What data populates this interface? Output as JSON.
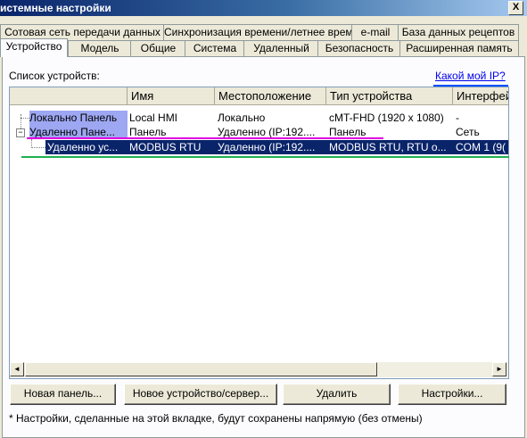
{
  "window": {
    "title": "истемные настройки",
    "close_label": "X"
  },
  "tabs_row1": [
    {
      "label": "Сотовая сеть передачи данных"
    },
    {
      "label": "Синхронизация времени/летнее время"
    },
    {
      "label": "e-mail"
    },
    {
      "label": "База данных рецептов"
    }
  ],
  "tabs_row2": [
    {
      "label": "Устройство",
      "active": true
    },
    {
      "label": "Модель"
    },
    {
      "label": "Общие"
    },
    {
      "label": "Система"
    },
    {
      "label": "Удаленный"
    },
    {
      "label": "Безопасность"
    },
    {
      "label": "Расширенная память"
    }
  ],
  "panel": {
    "list_label": "Список устройств:",
    "ip_link": "Какой мой IP?"
  },
  "table": {
    "columns": [
      "",
      "Имя",
      "Местоположение",
      "Тип устройства",
      "Интерфей"
    ],
    "rows": [
      {
        "tree": "Локально Панель",
        "name": "Local HMI",
        "location": "Локально",
        "type": "cMT-FHD (1920 x 1080)",
        "iface": "-"
      },
      {
        "tree": "Удаленно Пане...",
        "name": "Панель",
        "location": "Удаленно (IP:192....",
        "type": "Панель",
        "iface": "Сеть"
      },
      {
        "tree": "Удаленно ус...",
        "name": "MODBUS RTU",
        "location": "Удаленно (IP:192....",
        "type": "MODBUS RTU, RTU o...",
        "iface": "COM 1 (9("
      }
    ]
  },
  "scroll": {
    "left": "◄",
    "right": "►"
  },
  "buttons": {
    "new_panel": "Новая панель...",
    "new_device": "Новое устройство/сервер...",
    "delete": "Удалить",
    "settings": "Настройки..."
  },
  "note": "* Настройки, сделанные на этой вкладке, будут сохранены напрямую (без отмены)",
  "colors": {
    "selection": "#0a246a",
    "highlight": "#9ea7f2",
    "pink_mark": "#e000e0",
    "green_mark": "#20b050"
  }
}
